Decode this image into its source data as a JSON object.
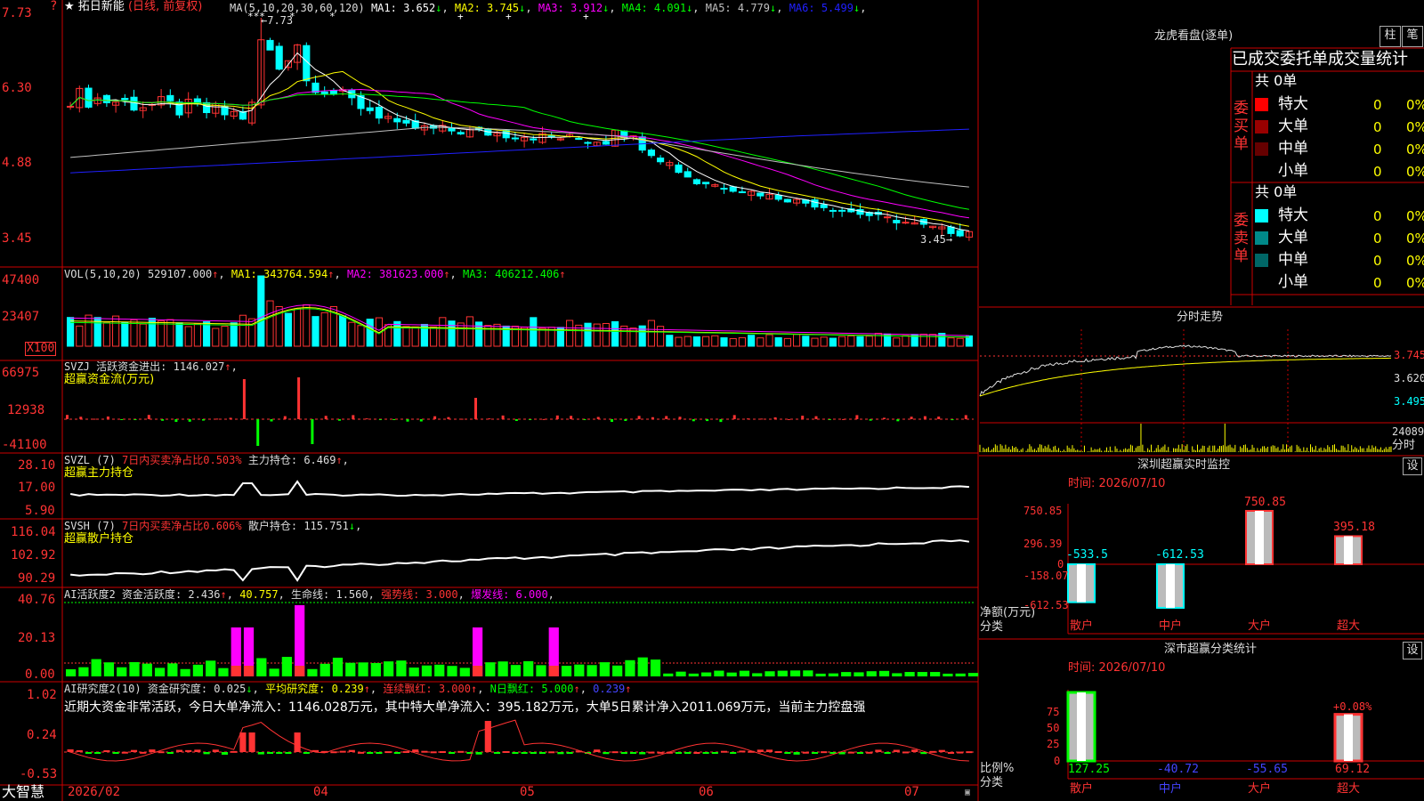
{
  "stock": {
    "star": "★",
    "name": "拓日新能",
    "mode": "(日线, 前复权)"
  },
  "brand": "大智慧",
  "help": "?",
  "candle_panel": {
    "ma_label": "MA(5,10,20,30,60,120)",
    "ma": [
      {
        "name": "MA1",
        "value": "3.652",
        "arrow": "↓",
        "color": "#ffffff"
      },
      {
        "name": "MA2",
        "value": "3.745",
        "arrow": "↓",
        "color": "#ffff00"
      },
      {
        "name": "MA3",
        "value": "3.912",
        "arrow": "↓",
        "color": "#ff00ff"
      },
      {
        "name": "MA4",
        "value": "4.091",
        "arrow": "↓",
        "color": "#00ff00"
      },
      {
        "name": "MA5",
        "value": "4.779",
        "arrow": "↓",
        "color": "#c0c0c0"
      },
      {
        "name": "MA6",
        "value": "5.499",
        "arrow": "↓",
        "color": "#2020ff"
      }
    ],
    "yticks": [
      "7.73",
      "6.30",
      "4.88",
      "3.45"
    ],
    "high_label": "7.73",
    "low_label": "3.45",
    "markers": [
      "***",
      "*",
      "*",
      "+",
      "+",
      "+"
    ]
  },
  "vol_panel": {
    "label": "VOL(5,10,20)",
    "value": "529107.000",
    "arrow": "↑",
    "ma": [
      {
        "name": "MA1",
        "value": "343764.594",
        "arrow": "↑",
        "color": "#ffff00"
      },
      {
        "name": "MA2",
        "value": "381623.000",
        "arrow": "↑",
        "color": "#ff00ff"
      },
      {
        "name": "MA3",
        "value": "406212.406",
        "arrow": "↑",
        "color": "#00ff00"
      }
    ],
    "yticks": [
      "47400",
      "23407"
    ],
    "unit": "X100"
  },
  "svzj_panel": {
    "label": "SVZJ",
    "text": "活跃资金进出",
    "value": "1146.027",
    "arrow": "↑",
    "sub": "超赢资金流(万元)",
    "yticks": [
      "66975",
      "12938",
      "-41100"
    ]
  },
  "svzl_panel": {
    "label": "SVZL (7)",
    "text": "7日内买卖净占比0.503%",
    "hold": "主力持仓",
    "value": "6.469",
    "arrow": "↑",
    "sub": "超赢主力持仓",
    "yticks": [
      "28.10",
      "17.00",
      "5.90"
    ]
  },
  "svsh_panel": {
    "label": "SVSH (7)",
    "text": "7日内买卖净占比0.606%",
    "hold": "散户持仓",
    "value": "115.751",
    "arrow": "↓",
    "sub": "超赢散户持仓",
    "yticks": [
      "116.04",
      "102.92",
      "90.29"
    ]
  },
  "ai_active_panel": {
    "label": "AI活跃度2",
    "fund": "资金活跃度",
    "fund_value": "2.436",
    "fund_arrow": "↑",
    "v2": "40.757",
    "life": "生命线",
    "life_value": "1.560",
    "strong": "强势线: 3.000",
    "burst": "爆发线: 6.000",
    "yticks": [
      "40.76",
      "20.13",
      "0.00"
    ]
  },
  "ai_research_panel": {
    "label": "AI研究度2(10)",
    "fund": "资金研究度",
    "fund_value": "0.025",
    "fund_arrow": "↓",
    "avg": "平均研究度",
    "avg_value": "0.239",
    "avg_arrow": "↑",
    "cont": "连续飘红",
    "cont_value": "3.000",
    "cont_arrow": "↑",
    "nday": "N日飘红",
    "nday_value": "5.000",
    "nday_arrow": "↑",
    "extra": "0.239",
    "extra_arrow": "↑",
    "comment": "近期大资金非常活跃，今日大单净流入：1146.028万元，其中特大单净流入：395.182万元，大单5日累计净入2011.069万元，当前主力控盘强",
    "yticks": [
      "1.02",
      "0.24",
      "-0.53"
    ]
  },
  "xaxis": [
    "2026/02",
    "04",
    "05",
    "06",
    "07"
  ],
  "right": {
    "lhb_title": "龙虎看盘(逐单)",
    "btn_bar": "柱",
    "btn_pen": "笔",
    "stats_title": "已成交委托单成交量统计",
    "buy": {
      "label": "委买单",
      "total": "共 0单",
      "rows": [
        {
          "name": "特大",
          "color": "#ff0000",
          "count": "0",
          "pct": "0%"
        },
        {
          "name": "大单",
          "color": "#990000",
          "count": "0",
          "pct": "0%"
        },
        {
          "name": "中单",
          "color": "#660000",
          "count": "0",
          "pct": "0%"
        },
        {
          "name": "小单",
          "color": "",
          "count": "0",
          "pct": "0%"
        }
      ]
    },
    "sell": {
      "label": "委卖单",
      "total": "共 0单",
      "rows": [
        {
          "name": "特大",
          "color": "#00ffff",
          "count": "0",
          "pct": "0%"
        },
        {
          "name": "大单",
          "color": "#008888",
          "count": "0",
          "pct": "0%"
        },
        {
          "name": "中单",
          "color": "#006666",
          "count": "0",
          "pct": "0%"
        },
        {
          "name": "小单",
          "color": "",
          "count": "0",
          "pct": "0%"
        }
      ]
    },
    "intraday": {
      "title": "分时走势",
      "yticks": [
        "3.745",
        "3.620",
        "3.495"
      ],
      "vol_value": "24089",
      "vol_unit": "分时"
    },
    "monitor": {
      "title": "深圳超赢实时监控",
      "set": "设",
      "time": "时间: 2026/07/10",
      "yticks": [
        "750.85",
        "296.39",
        "0",
        "-158.07",
        "-612.53"
      ],
      "ylabel1": "净额(万元)",
      "ylabel2": "分类",
      "bars": [
        {
          "cat": "散户",
          "value": -533.5,
          "label": "-533.5"
        },
        {
          "cat": "中户",
          "value": -612.53,
          "label": "-612.53"
        },
        {
          "cat": "大户",
          "value": 750.85,
          "label": "750.85"
        },
        {
          "cat": "超大",
          "value": 395.18,
          "label": "395.18"
        }
      ]
    },
    "classify": {
      "title": "深市超赢分类统计",
      "set": "设",
      "time": "时间: 2026/07/10",
      "yticks": [
        "75",
        "50",
        "25",
        "0"
      ],
      "ylabel1": "比例%",
      "ylabel2": "分类",
      "cats": [
        {
          "cat": "散户",
          "value": "127.25",
          "pct": 100,
          "pct_label": ""
        },
        {
          "cat": "中户",
          "value": "-40.72",
          "pct": 0,
          "pct_label": ""
        },
        {
          "cat": "大户",
          "value": "-55.65",
          "pct": 0,
          "pct_label": ""
        },
        {
          "cat": "超大",
          "value": "69.12",
          "pct": 68,
          "pct_label": "+0.08%"
        }
      ]
    }
  }
}
